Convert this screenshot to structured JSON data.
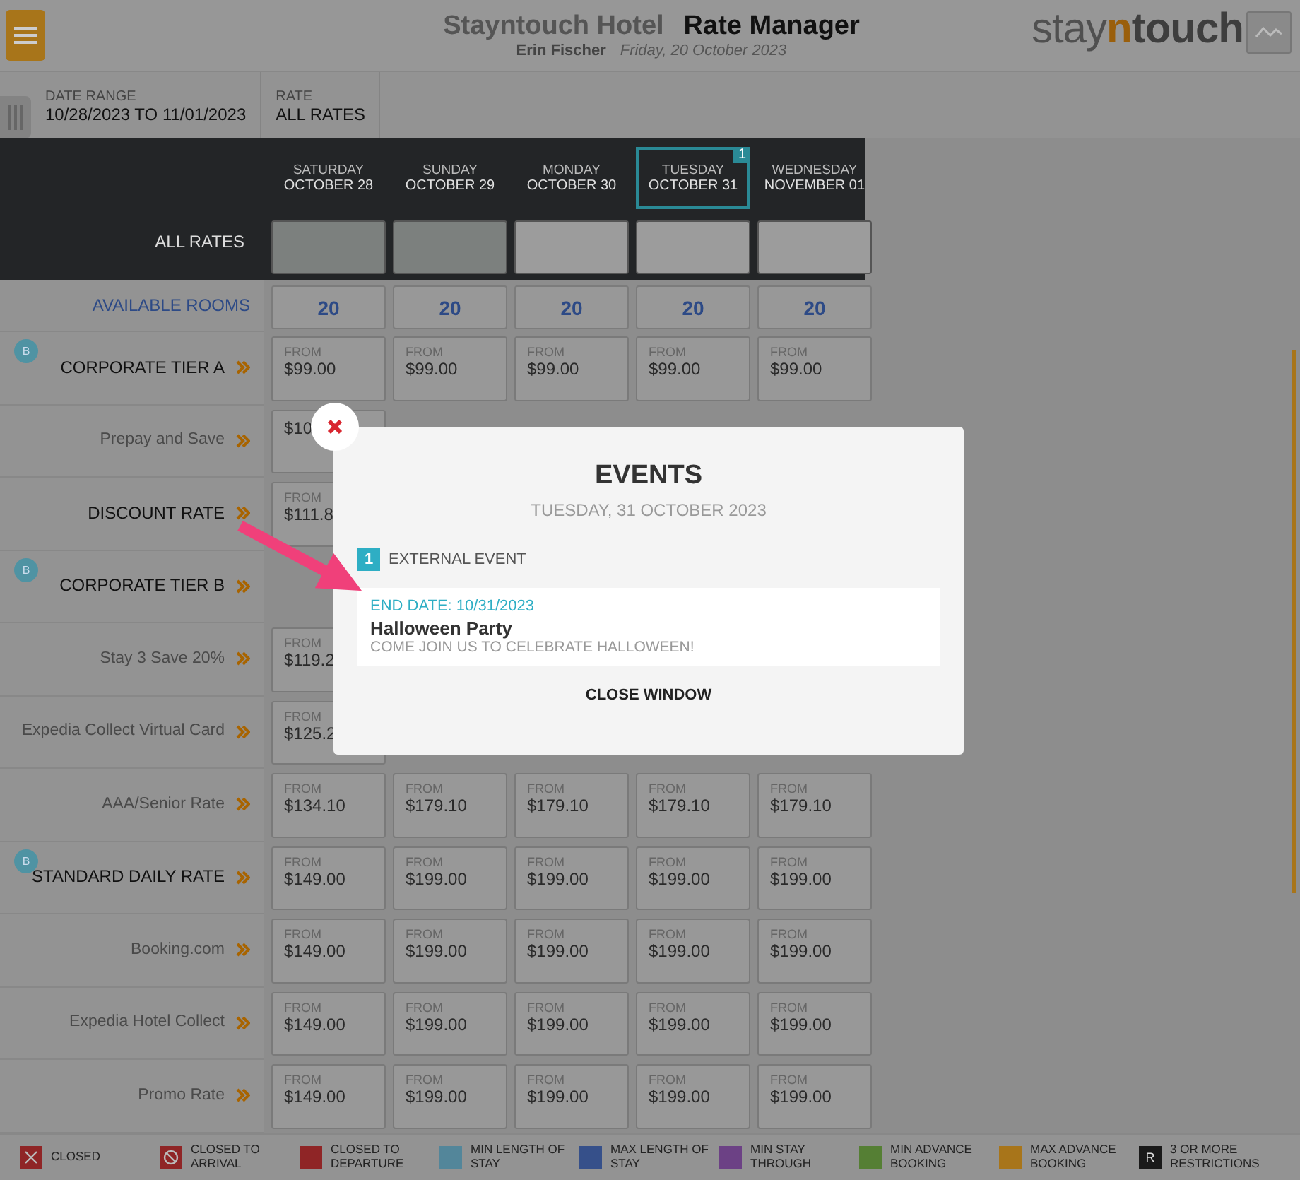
{
  "header": {
    "hotel": "Stayntouch Hotel",
    "module": "Rate Manager",
    "user": "Erin Fischer",
    "date": "Friday, 20 October 2023",
    "logo": {
      "start": "stay",
      "accent": "n",
      "end": "touch"
    }
  },
  "filters": [
    {
      "label": "DATE RANGE",
      "value": "10/28/2023 TO 11/01/2023"
    },
    {
      "label": "RATE",
      "value": "ALL RATES"
    }
  ],
  "dates": [
    {
      "weekday": "SATURDAY",
      "date": "OCTOBER 28",
      "selected": false
    },
    {
      "weekday": "SUNDAY",
      "date": "OCTOBER 29",
      "selected": false
    },
    {
      "weekday": "MONDAY",
      "date": "OCTOBER 30",
      "selected": false
    },
    {
      "weekday": "TUESDAY",
      "date": "OCTOBER 31",
      "selected": true,
      "event_count": "1"
    },
    {
      "weekday": "WEDNESDAY",
      "date": "NOVEMBER 01",
      "selected": false
    }
  ],
  "all_rates": {
    "label": "ALL RATES",
    "cells": [
      {
        "shaded": true
      },
      {
        "shaded": true
      },
      {
        "shaded": false
      },
      {
        "shaded": false
      },
      {
        "shaded": false
      }
    ]
  },
  "available_rooms": {
    "label": "AVAILABLE ROOMS",
    "values": [
      "20",
      "20",
      "20",
      "20",
      "20"
    ]
  },
  "rates": [
    {
      "name": "CORPORATE TIER A",
      "emphasized": true,
      "badge": "B",
      "cells": [
        {
          "label": "FROM",
          "price": "$99.00"
        },
        {
          "label": "FROM",
          "price": "$99.00"
        },
        {
          "label": "FROM",
          "price": "$99.00"
        },
        {
          "label": "FROM",
          "price": "$99.00"
        },
        {
          "label": "FROM",
          "price": "$99.00"
        }
      ]
    },
    {
      "name": "Prepay and Save",
      "emphasized": false,
      "cells": [
        {
          "price": "$10"
        }
      ]
    },
    {
      "name": "DISCOUNT RATE",
      "emphasized": true,
      "cells": [
        {
          "label": "FROM",
          "price": "$111.8"
        }
      ]
    },
    {
      "name": "CORPORATE TIER B",
      "emphasized": true,
      "badge": "B"
    },
    {
      "name": "Stay 3 Save 20%",
      "emphasized": false,
      "cells": [
        {
          "label": "FROM",
          "price": "$119.2"
        }
      ]
    },
    {
      "name": "Expedia Collect Virtual Card",
      "emphasized": false,
      "cells": [
        {
          "label": "FROM",
          "price": "$125.2"
        }
      ]
    },
    {
      "name": "AAA/Senior Rate",
      "emphasized": false,
      "cells": [
        {
          "label": "FROM",
          "price": "$134.10"
        },
        {
          "label": "FROM",
          "price": "$179.10"
        },
        {
          "label": "FROM",
          "price": "$179.10"
        },
        {
          "label": "FROM",
          "price": "$179.10"
        },
        {
          "label": "FROM",
          "price": "$179.10"
        }
      ]
    },
    {
      "name": "STANDARD DAILY RATE",
      "emphasized": true,
      "badge": "B",
      "cells": [
        {
          "label": "FROM",
          "price": "$149.00"
        },
        {
          "label": "FROM",
          "price": "$199.00"
        },
        {
          "label": "FROM",
          "price": "$199.00"
        },
        {
          "label": "FROM",
          "price": "$199.00"
        },
        {
          "label": "FROM",
          "price": "$199.00"
        }
      ]
    },
    {
      "name": "Booking.com",
      "emphasized": false,
      "cells": [
        {
          "label": "FROM",
          "price": "$149.00"
        },
        {
          "label": "FROM",
          "price": "$199.00"
        },
        {
          "label": "FROM",
          "price": "$199.00"
        },
        {
          "label": "FROM",
          "price": "$199.00"
        },
        {
          "label": "FROM",
          "price": "$199.00"
        }
      ]
    },
    {
      "name": "Expedia Hotel Collect",
      "emphasized": false,
      "cells": [
        {
          "label": "FROM",
          "price": "$149.00"
        },
        {
          "label": "FROM",
          "price": "$199.00"
        },
        {
          "label": "FROM",
          "price": "$199.00"
        },
        {
          "label": "FROM",
          "price": "$199.00"
        },
        {
          "label": "FROM",
          "price": "$199.00"
        }
      ]
    },
    {
      "name": "Promo Rate",
      "emphasized": false,
      "cells": [
        {
          "label": "FROM",
          "price": "$149.00"
        },
        {
          "label": "FROM",
          "price": "$199.00"
        },
        {
          "label": "FROM",
          "price": "$199.00"
        },
        {
          "label": "FROM",
          "price": "$199.00"
        },
        {
          "label": "FROM",
          "price": "$199.00"
        }
      ]
    }
  ],
  "legend": [
    {
      "kind": "cross",
      "label": "CLOSED",
      "color": "#8f2526"
    },
    {
      "kind": "no-entry",
      "label": "CLOSED TO ARRIVAL",
      "color": "#8f2526"
    },
    {
      "kind": "swatch",
      "label": "CLOSED TO DEPARTURE",
      "color": "#8f2526"
    },
    {
      "kind": "swatch",
      "label": "MIN LENGTH OF STAY",
      "color": "#53869a"
    },
    {
      "kind": "swatch",
      "label": "MAX LENGTH OF STAY",
      "color": "#36508a"
    },
    {
      "kind": "swatch",
      "label": "MIN STAY THROUGH",
      "color": "#6c4185"
    },
    {
      "kind": "swatch",
      "label": "MIN ADVANCE BOOKING",
      "color": "#557f34"
    },
    {
      "kind": "swatch",
      "label": "MAX ADVANCE BOOKING",
      "color": "#a8751a"
    },
    {
      "kind": "letter",
      "letter": "R",
      "label": "3 OR MORE RESTRICTIONS",
      "color": "#1a1a1a"
    }
  ],
  "modal": {
    "title": "EVENTS",
    "date": "TUESDAY, 31 OCTOBER 2023",
    "count": "1",
    "group": "EXTERNAL EVENT",
    "events": [
      {
        "end_date": "END DATE: 10/31/2023",
        "name": "Halloween Party",
        "description": "COME JOIN US TO CELEBRATE HALLOWEEN!"
      }
    ],
    "close": "CLOSE WINDOW"
  }
}
